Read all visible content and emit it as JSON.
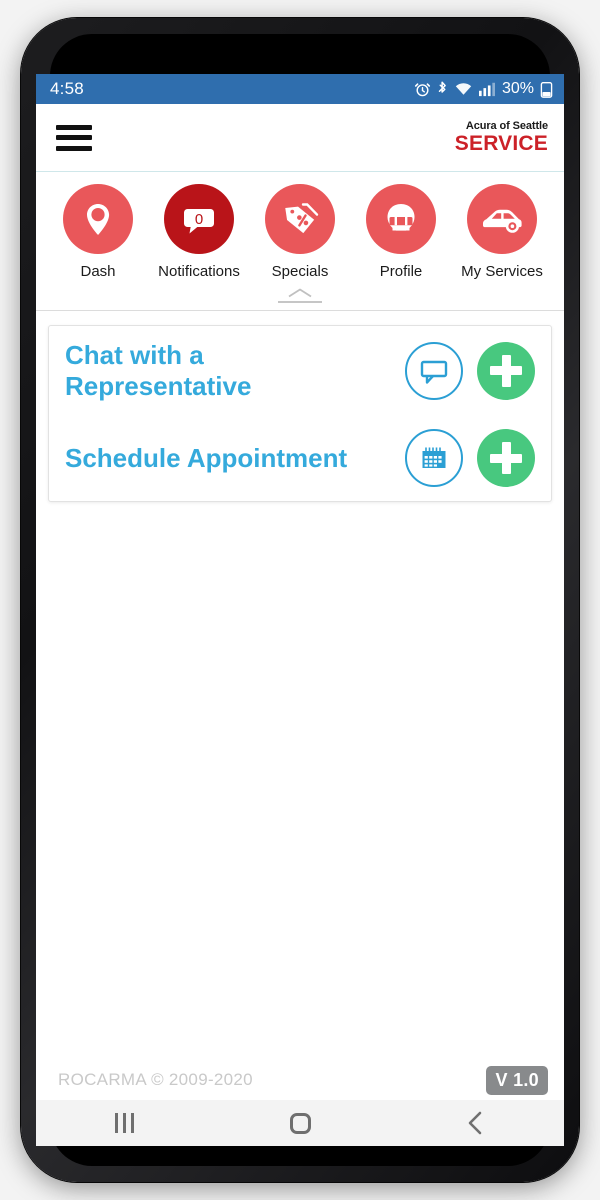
{
  "status_bar": {
    "time": "4:58",
    "battery_percent": "30%",
    "icons": [
      "alarm-icon",
      "bluetooth-icon",
      "wifi-icon",
      "cellular-signal-icon",
      "battery-icon"
    ],
    "background_color": "#2f6eae"
  },
  "app_header": {
    "menu_icon": "hamburger-menu-icon",
    "brand_top": "Acura of Seattle",
    "brand_main": "SERVICE",
    "brand_color": "#cc2128"
  },
  "nav_icons": [
    {
      "label": "Dash",
      "icon": "location-pin-icon",
      "highlighted": false
    },
    {
      "label": "Notifications",
      "icon": "speech-bubble-icon",
      "badge_count": "0",
      "highlighted": true
    },
    {
      "label": "Specials",
      "icon": "price-tag-percent-icon",
      "highlighted": false
    },
    {
      "label": "Profile",
      "icon": "helmet-icon",
      "highlighted": false
    },
    {
      "label": "My Services",
      "icon": "car-icon",
      "highlighted": false
    }
  ],
  "collapse_handle": {
    "icon": "chevron-up-icon"
  },
  "actions": [
    {
      "title": "Chat with a Representative",
      "icon": "chat-bubble-icon",
      "add_icon": "plus-icon"
    },
    {
      "title": "Schedule Appointment",
      "icon": "calendar-icon",
      "add_icon": "plus-icon"
    }
  ],
  "footer": {
    "copyright": "ROCARMA © 2009-2020",
    "version": "V 1.0"
  },
  "system_nav": {
    "recents": "recents-icon",
    "home": "home-icon",
    "back": "back-icon"
  },
  "colors": {
    "accent_red": "#e9575a",
    "accent_red_dark": "#b91419",
    "accent_blue": "#35aadc",
    "accent_green": "#48c87f",
    "status_blue": "#2f6eae"
  }
}
